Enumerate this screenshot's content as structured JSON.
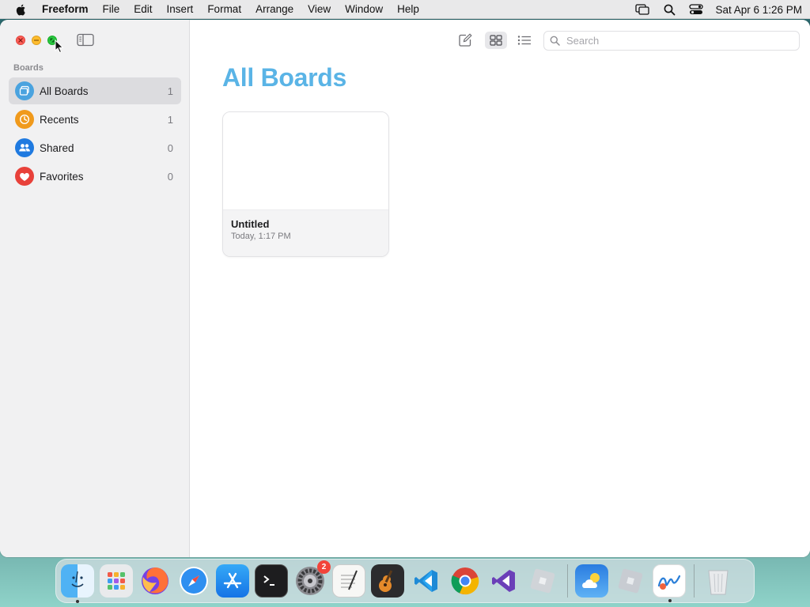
{
  "menubar": {
    "app_name": "Freeform",
    "menus": [
      "File",
      "Edit",
      "Insert",
      "Format",
      "Arrange",
      "View",
      "Window",
      "Help"
    ],
    "clock": "Sat Apr 6  1:26 PM"
  },
  "sidebar": {
    "section_label": "Boards",
    "items": [
      {
        "label": "All Boards",
        "count": "1",
        "icon": "all-boards-icon",
        "color": "#4aa3df",
        "selected": true
      },
      {
        "label": "Recents",
        "count": "1",
        "icon": "clock-icon",
        "color": "#f09a1c",
        "selected": false
      },
      {
        "label": "Shared",
        "count": "0",
        "icon": "people-icon",
        "color": "#1f7ae0",
        "selected": false
      },
      {
        "label": "Favorites",
        "count": "0",
        "icon": "heart-icon",
        "color": "#e8413a",
        "selected": false
      }
    ]
  },
  "main": {
    "title": "All Boards",
    "search_placeholder": "Search",
    "boards": [
      {
        "title": "Untitled",
        "date": "Today, 1:17 PM"
      }
    ]
  },
  "dock": {
    "apps": [
      "finder",
      "launchpad",
      "firefox",
      "safari",
      "app-store",
      "terminal",
      "system-settings",
      "textedit",
      "garageband",
      "vscode",
      "chrome",
      "visual-studio",
      "roblox-studio",
      "weather",
      "roblox",
      "freeform",
      "trash"
    ],
    "settings_badge": "2"
  },
  "colors": {
    "accent": "#5ab4e6",
    "title_color": "#5ab4e6"
  }
}
